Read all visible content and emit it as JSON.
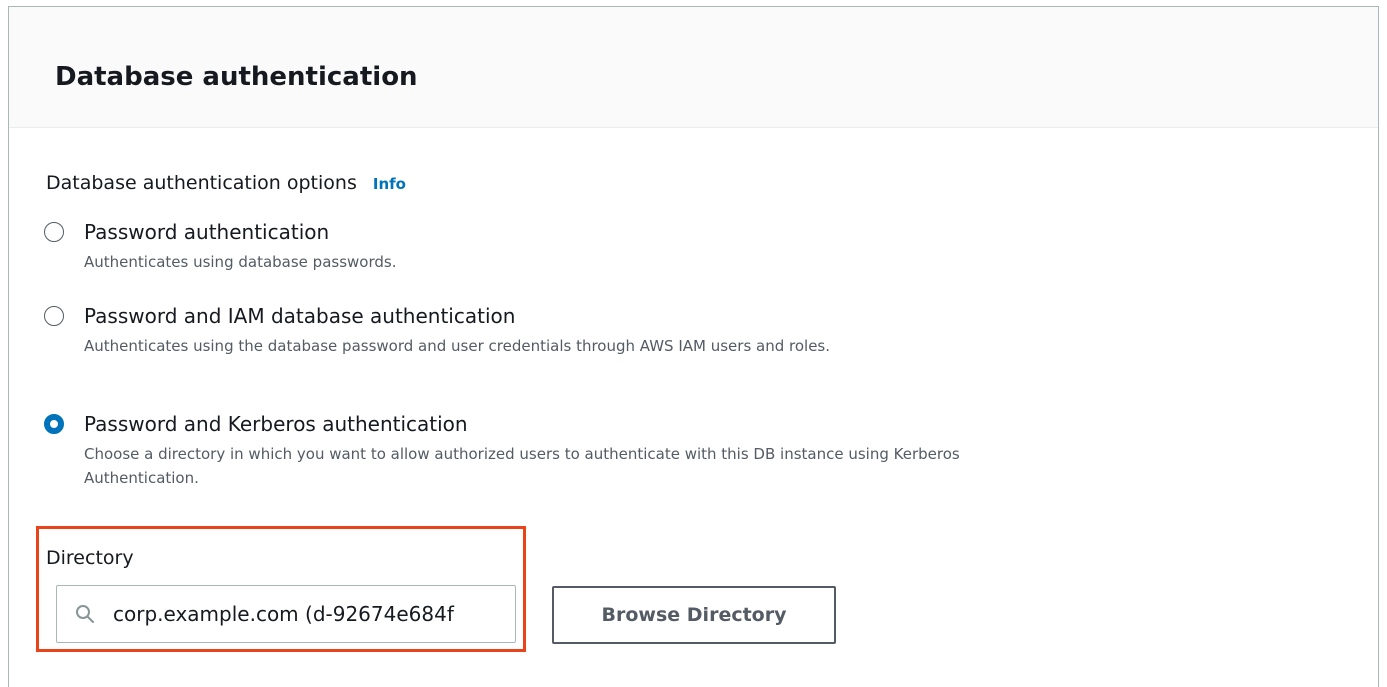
{
  "panel": {
    "title": "Database authentication"
  },
  "auth_options": {
    "label": "Database authentication options",
    "info_link": "Info",
    "options": [
      {
        "title": "Password authentication",
        "description": "Authenticates using database passwords.",
        "selected": false
      },
      {
        "title": "Password and IAM database authentication",
        "description": "Authenticates using the database password and user credentials through AWS IAM users and roles.",
        "selected": false
      },
      {
        "title": "Password and Kerberos authentication",
        "description": "Choose a directory in which you want to allow authorized users to authenticate with this DB instance using Kerberos Authentication.",
        "selected": true
      }
    ]
  },
  "directory": {
    "label": "Directory",
    "value": "corp.example.com (d-92674e684f",
    "browse_label": "Browse Directory",
    "search_icon": "search-icon"
  },
  "colors": {
    "accent": "#0073bb",
    "highlight": "#e8431b",
    "text": "#16191f",
    "secondary_text": "#545b64"
  }
}
